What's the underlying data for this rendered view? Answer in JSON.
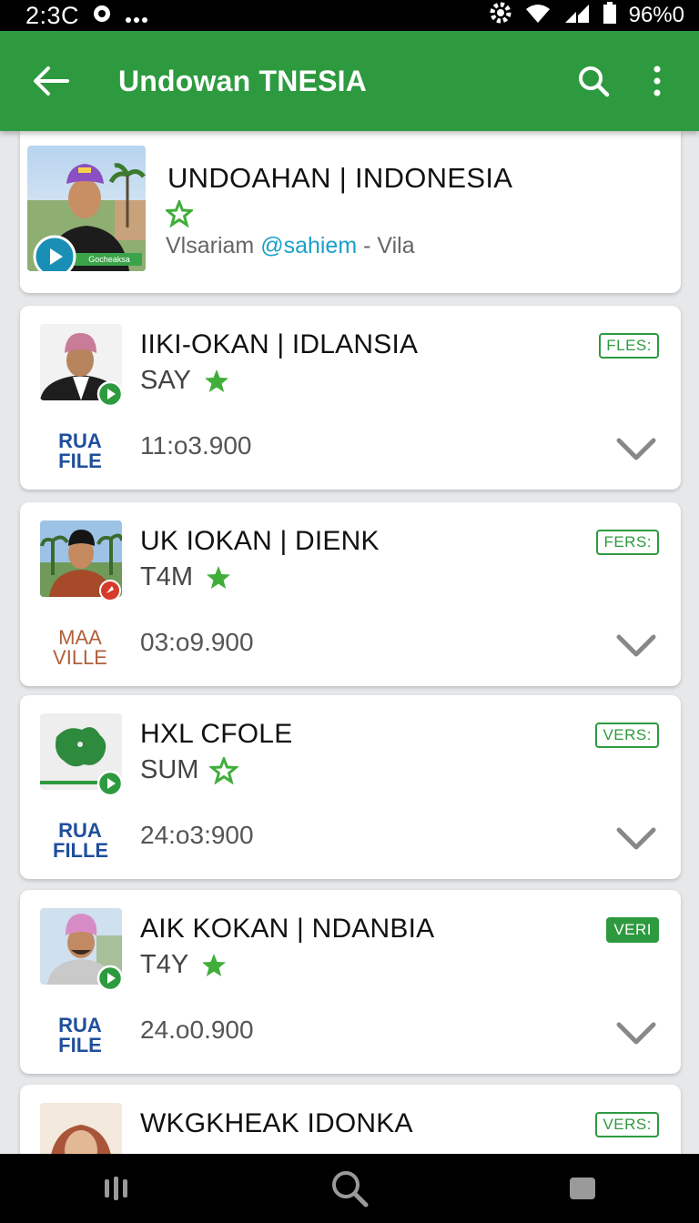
{
  "status_bar": {
    "time": "2:3C",
    "battery": "96%0",
    "icons": [
      "whatsapp-icon",
      "more-dots-icon",
      "settings-gear-icon",
      "wifi-icon",
      "signal-icon",
      "battery-icon"
    ]
  },
  "app_bar": {
    "title": "Undowan TNESIA",
    "icons": [
      "back-arrow-icon",
      "search-icon",
      "more-vert-icon"
    ],
    "color": "#2e9a3f"
  },
  "header": {
    "title": "UNDOAHAN | INDONESIA",
    "subtitle_prefix": "Vlsariam ",
    "subtitle_handle": "@sahiem",
    "subtitle_suffix": " - Vila",
    "thumb_caption": "Gocheaksa"
  },
  "items": [
    {
      "title": "IIKI-OKAN | IDLANSIA",
      "code": "SAY",
      "time": "11:o3.900",
      "badge": "FLES:",
      "logo_line1": "RUA",
      "logo_line2": "FILE"
    },
    {
      "title": "UK IOKAN | DIENK",
      "code": "T4M",
      "time": "03:o9.900",
      "badge": "FERS:",
      "logo_line1": "MAA",
      "logo_line2": "VILLE"
    },
    {
      "title": "HXL CFOLE",
      "code": "SUM",
      "time": "24:o3:900",
      "badge": "VERS:",
      "logo_line1": "RUA",
      "logo_line2": "FILLE"
    },
    {
      "title": "AIK KOKAN | NDANBIA",
      "code": "T4Y",
      "time": "24.o0.900",
      "badge": "VERI",
      "logo_line1": "RUA",
      "logo_line2": "FILE"
    },
    {
      "title": "WKGKHEAK IDONKA",
      "code": "",
      "time": "",
      "badge": "VERS:",
      "logo_line1": "",
      "logo_line2": ""
    }
  ],
  "colors": {
    "accent": "#2e9a3f",
    "star": "#3fae3a",
    "handle": "#1a9fc9",
    "logo": "#1f4f9c"
  },
  "nav_bar": {
    "icons": [
      "recent-apps-icon",
      "search-icon",
      "home-square-icon"
    ]
  }
}
